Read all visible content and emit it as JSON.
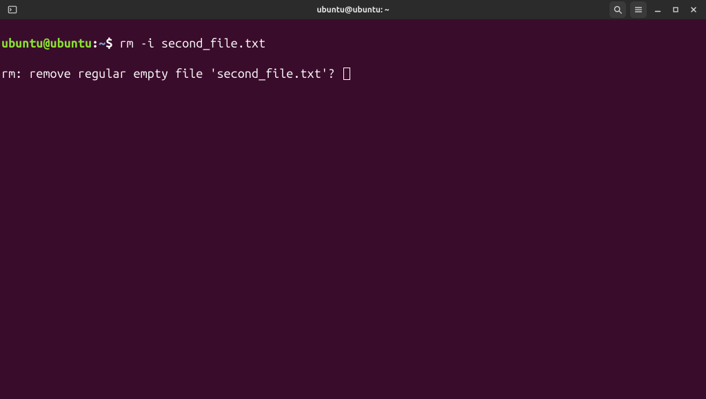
{
  "window": {
    "title": "ubuntu@ubuntu: ~"
  },
  "terminal": {
    "prompt": {
      "user_host": "ubuntu@ubuntu",
      "colon": ":",
      "path": "~",
      "dollar": "$ "
    },
    "command": "rm -i second_file.txt",
    "output_line": "rm: remove regular empty file 'second_file.txt'? "
  }
}
